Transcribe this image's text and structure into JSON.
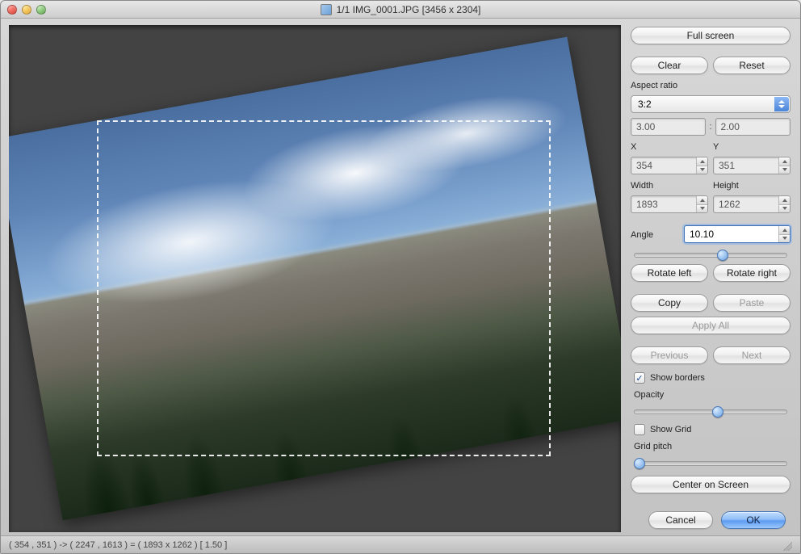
{
  "window": {
    "title": "1/1 IMG_0001.JPG [3456 x 2304]"
  },
  "sidebar": {
    "full_screen": "Full screen",
    "clear": "Clear",
    "reset": "Reset",
    "aspect_ratio_label": "Aspect ratio",
    "aspect_ratio_value": "3:2",
    "aspect_w": "3.00",
    "aspect_h": "2.00",
    "x_label": "X",
    "y_label": "Y",
    "x_value": "354",
    "y_value": "351",
    "width_label": "Width",
    "height_label": "Height",
    "width_value": "1893",
    "height_value": "1262",
    "angle_label": "Angle",
    "angle_value": "10.10",
    "angle_slider_pct": 58,
    "rotate_left": "Rotate left",
    "rotate_right": "Rotate right",
    "copy": "Copy",
    "paste": "Paste",
    "apply_all": "Apply All",
    "previous": "Previous",
    "next": "Next",
    "show_borders_label": "Show borders",
    "show_borders_checked": true,
    "opacity_label": "Opacity",
    "opacity_slider_pct": 55,
    "show_grid_label": "Show Grid",
    "show_grid_checked": false,
    "grid_pitch_label": "Grid pitch",
    "grid_pitch_slider_pct": 3,
    "center_on_screen": "Center on Screen",
    "cancel": "Cancel",
    "ok": "OK"
  },
  "statusbar": {
    "text": "( 354 , 351 ) -> ( 2247 , 1613 ) = ( 1893 x 1262 ) [ 1.50 ]"
  }
}
